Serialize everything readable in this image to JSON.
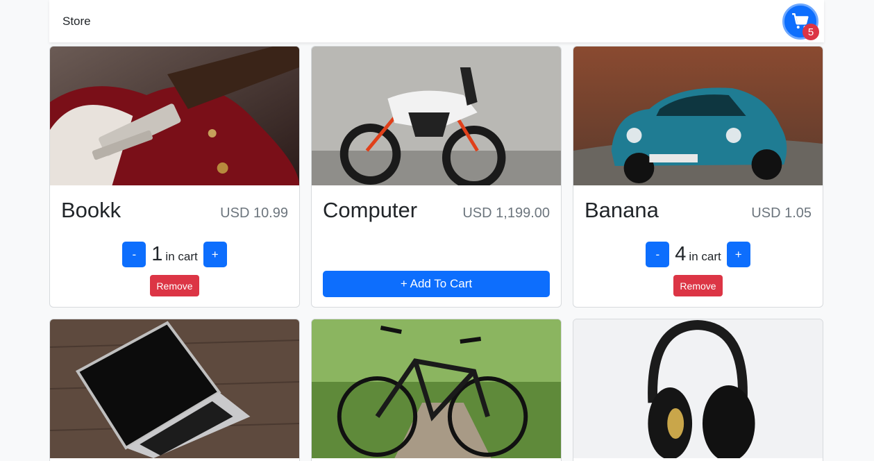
{
  "navbar": {
    "brand": "Store",
    "cart_count": "5"
  },
  "products": [
    {
      "name": "Bookk",
      "price": "USD 10.99",
      "quantity": "1",
      "in_cart_label": "in cart",
      "minus": "-",
      "plus": "+",
      "remove": "Remove"
    },
    {
      "name": "Computer",
      "price": "USD 1,199.00",
      "add_to_cart": "+ Add To Cart"
    },
    {
      "name": "Banana",
      "price": "USD 1.05",
      "quantity": "4",
      "in_cart_label": "in cart",
      "minus": "-",
      "plus": "+",
      "remove": "Remove"
    },
    {
      "image": "laptop"
    },
    {
      "image": "bicycle"
    },
    {
      "image": "headphones"
    }
  ],
  "colors": {
    "primary": "#0d6efd",
    "danger": "#dc3545",
    "muted": "#6c757d"
  }
}
